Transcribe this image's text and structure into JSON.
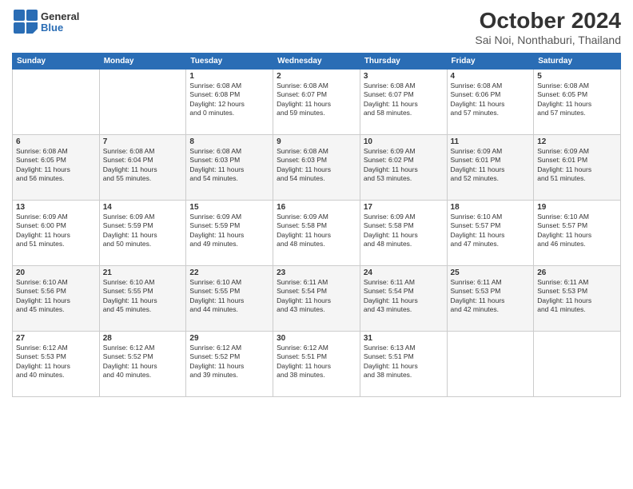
{
  "header": {
    "logo_line1": "General",
    "logo_line2": "Blue",
    "title": "October 2024",
    "subtitle": "Sai Noi, Nonthaburi, Thailand"
  },
  "days_of_week": [
    "Sunday",
    "Monday",
    "Tuesday",
    "Wednesday",
    "Thursday",
    "Friday",
    "Saturday"
  ],
  "weeks": [
    [
      {
        "day": "",
        "info": ""
      },
      {
        "day": "",
        "info": ""
      },
      {
        "day": "1",
        "info": "Sunrise: 6:08 AM\nSunset: 6:08 PM\nDaylight: 12 hours\nand 0 minutes."
      },
      {
        "day": "2",
        "info": "Sunrise: 6:08 AM\nSunset: 6:07 PM\nDaylight: 11 hours\nand 59 minutes."
      },
      {
        "day": "3",
        "info": "Sunrise: 6:08 AM\nSunset: 6:07 PM\nDaylight: 11 hours\nand 58 minutes."
      },
      {
        "day": "4",
        "info": "Sunrise: 6:08 AM\nSunset: 6:06 PM\nDaylight: 11 hours\nand 57 minutes."
      },
      {
        "day": "5",
        "info": "Sunrise: 6:08 AM\nSunset: 6:05 PM\nDaylight: 11 hours\nand 57 minutes."
      }
    ],
    [
      {
        "day": "6",
        "info": "Sunrise: 6:08 AM\nSunset: 6:05 PM\nDaylight: 11 hours\nand 56 minutes."
      },
      {
        "day": "7",
        "info": "Sunrise: 6:08 AM\nSunset: 6:04 PM\nDaylight: 11 hours\nand 55 minutes."
      },
      {
        "day": "8",
        "info": "Sunrise: 6:08 AM\nSunset: 6:03 PM\nDaylight: 11 hours\nand 54 minutes."
      },
      {
        "day": "9",
        "info": "Sunrise: 6:08 AM\nSunset: 6:03 PM\nDaylight: 11 hours\nand 54 minutes."
      },
      {
        "day": "10",
        "info": "Sunrise: 6:09 AM\nSunset: 6:02 PM\nDaylight: 11 hours\nand 53 minutes."
      },
      {
        "day": "11",
        "info": "Sunrise: 6:09 AM\nSunset: 6:01 PM\nDaylight: 11 hours\nand 52 minutes."
      },
      {
        "day": "12",
        "info": "Sunrise: 6:09 AM\nSunset: 6:01 PM\nDaylight: 11 hours\nand 51 minutes."
      }
    ],
    [
      {
        "day": "13",
        "info": "Sunrise: 6:09 AM\nSunset: 6:00 PM\nDaylight: 11 hours\nand 51 minutes."
      },
      {
        "day": "14",
        "info": "Sunrise: 6:09 AM\nSunset: 5:59 PM\nDaylight: 11 hours\nand 50 minutes."
      },
      {
        "day": "15",
        "info": "Sunrise: 6:09 AM\nSunset: 5:59 PM\nDaylight: 11 hours\nand 49 minutes."
      },
      {
        "day": "16",
        "info": "Sunrise: 6:09 AM\nSunset: 5:58 PM\nDaylight: 11 hours\nand 48 minutes."
      },
      {
        "day": "17",
        "info": "Sunrise: 6:09 AM\nSunset: 5:58 PM\nDaylight: 11 hours\nand 48 minutes."
      },
      {
        "day": "18",
        "info": "Sunrise: 6:10 AM\nSunset: 5:57 PM\nDaylight: 11 hours\nand 47 minutes."
      },
      {
        "day": "19",
        "info": "Sunrise: 6:10 AM\nSunset: 5:57 PM\nDaylight: 11 hours\nand 46 minutes."
      }
    ],
    [
      {
        "day": "20",
        "info": "Sunrise: 6:10 AM\nSunset: 5:56 PM\nDaylight: 11 hours\nand 45 minutes."
      },
      {
        "day": "21",
        "info": "Sunrise: 6:10 AM\nSunset: 5:55 PM\nDaylight: 11 hours\nand 45 minutes."
      },
      {
        "day": "22",
        "info": "Sunrise: 6:10 AM\nSunset: 5:55 PM\nDaylight: 11 hours\nand 44 minutes."
      },
      {
        "day": "23",
        "info": "Sunrise: 6:11 AM\nSunset: 5:54 PM\nDaylight: 11 hours\nand 43 minutes."
      },
      {
        "day": "24",
        "info": "Sunrise: 6:11 AM\nSunset: 5:54 PM\nDaylight: 11 hours\nand 43 minutes."
      },
      {
        "day": "25",
        "info": "Sunrise: 6:11 AM\nSunset: 5:53 PM\nDaylight: 11 hours\nand 42 minutes."
      },
      {
        "day": "26",
        "info": "Sunrise: 6:11 AM\nSunset: 5:53 PM\nDaylight: 11 hours\nand 41 minutes."
      }
    ],
    [
      {
        "day": "27",
        "info": "Sunrise: 6:12 AM\nSunset: 5:53 PM\nDaylight: 11 hours\nand 40 minutes."
      },
      {
        "day": "28",
        "info": "Sunrise: 6:12 AM\nSunset: 5:52 PM\nDaylight: 11 hours\nand 40 minutes."
      },
      {
        "day": "29",
        "info": "Sunrise: 6:12 AM\nSunset: 5:52 PM\nDaylight: 11 hours\nand 39 minutes."
      },
      {
        "day": "30",
        "info": "Sunrise: 6:12 AM\nSunset: 5:51 PM\nDaylight: 11 hours\nand 38 minutes."
      },
      {
        "day": "31",
        "info": "Sunrise: 6:13 AM\nSunset: 5:51 PM\nDaylight: 11 hours\nand 38 minutes."
      },
      {
        "day": "",
        "info": ""
      },
      {
        "day": "",
        "info": ""
      }
    ]
  ]
}
